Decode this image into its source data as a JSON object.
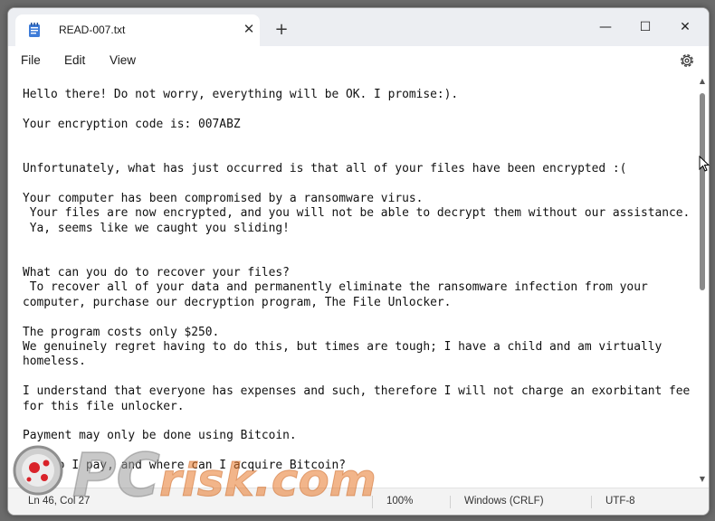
{
  "window": {
    "tab_title": "READ-007.txt",
    "tab_close": "✕",
    "new_tab": "+",
    "minimize": "—",
    "maximize": "☐",
    "close": "✕"
  },
  "menu": {
    "file": "File",
    "edit": "Edit",
    "view": "View"
  },
  "icons": {
    "tab": "notepad-icon",
    "settings": "gear-icon",
    "scroll_up": "▲",
    "scroll_down": "▼"
  },
  "document": {
    "lines": [
      "Hello there! Do not worry, everything will be OK. I promise:).",
      "",
      "Your encryption code is: 007ABZ",
      "",
      "",
      "Unfortunately, what has just occurred is that all of your files have been encrypted :(",
      "",
      "Your computer has been compromised by a ransomware virus.",
      " Your files are now encrypted, and you will not be able to decrypt them without our assistance.",
      " Ya, seems like we caught you sliding!",
      "",
      "",
      "What can you do to recover your files?",
      " To recover all of your data and permanently eliminate the ransomware infection from your",
      "computer, purchase our decryption program, The File Unlocker.",
      "",
      "The program costs only $250.",
      "We genuinely regret having to do this, but times are tough; I have a child and am virtually",
      "homeless.",
      "",
      "I understand that everyone has expenses and such, therefore I will not charge an exorbitant fee",
      "for this file unlocker.",
      "",
      "Payment may only be done using Bitcoin.",
      "",
      "How do I pay, and where can I acquire Bitcoin?"
    ]
  },
  "status": {
    "position": "Ln 46, Col 27",
    "zoom": "100%",
    "line_ending": "Windows (CRLF)",
    "encoding": "UTF-8"
  },
  "watermark": {
    "text_pc": "PC",
    "text_risk": "risk.com"
  },
  "colors": {
    "accent_blue": "#2a5fb0",
    "watermark_gray": "#9a9a9a",
    "watermark_orange": "#e8792a",
    "logo_red": "#d9232a"
  }
}
